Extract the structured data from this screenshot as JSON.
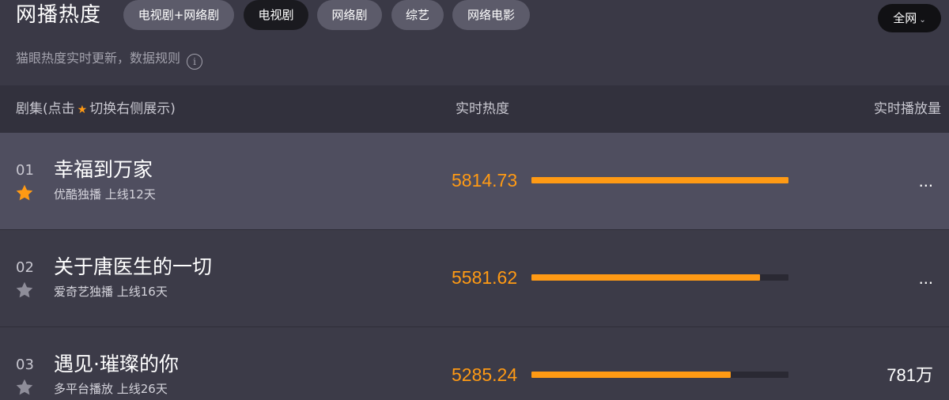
{
  "header": {
    "title": "网播热度",
    "tabs": [
      {
        "label": "电视剧+网络剧",
        "active": false
      },
      {
        "label": "电视剧",
        "active": true
      },
      {
        "label": "网络剧",
        "active": false
      },
      {
        "label": "综艺",
        "active": false
      },
      {
        "label": "网络电影",
        "active": false
      }
    ],
    "scope": {
      "label": "全网",
      "icon": "chevron-down-icon"
    },
    "subtitle": "猫眼热度实时更新，数据规则",
    "info_icon": "i"
  },
  "columns": {
    "show_label_pre": "剧集(点击",
    "show_label_post": "切换右侧展示)",
    "heat": "实时热度",
    "plays": "实时播放量"
  },
  "colors": {
    "accent": "#ff9a14",
    "star_active": "#ff9a14",
    "star_inactive": "#8e8d99"
  },
  "rows": [
    {
      "rank": "01",
      "title": "幸福到万家",
      "meta": "优酷独播  上线12天",
      "heat": "5814.73",
      "heat_fraction": 1.0,
      "plays": "...",
      "starred": true
    },
    {
      "rank": "02",
      "title": "关于唐医生的一切",
      "meta": "爱奇艺独播  上线16天",
      "heat": "5581.62",
      "heat_fraction": 0.888,
      "plays": "...",
      "starred": false
    },
    {
      "rank": "03",
      "title": "遇见·璀璨的你",
      "meta": "多平台播放  上线26天",
      "heat": "5285.24",
      "heat_fraction": 0.775,
      "plays": "781万",
      "starred": false
    }
  ]
}
